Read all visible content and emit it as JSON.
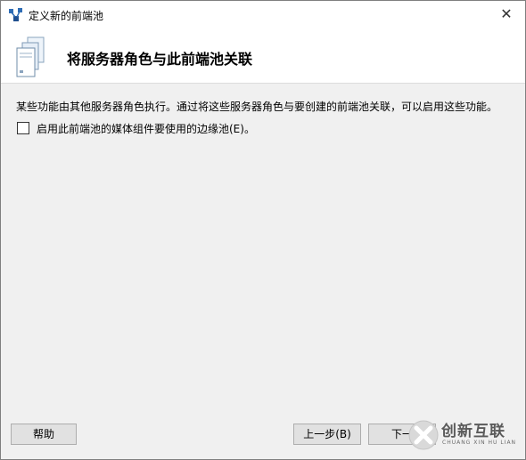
{
  "window": {
    "title": "定义新的前端池",
    "close_glyph": "✕"
  },
  "header": {
    "title": "将服务器角色与此前端池关联",
    "icon": "server-stack-icon"
  },
  "content": {
    "description": "某些功能由其他服务器角色执行。通过将这些服务器角色与要创建的前端池关联，可以启用这些功能。",
    "checkbox": {
      "label": "启用此前端池的媒体组件要使用的边缘池(E)。",
      "checked": false
    }
  },
  "buttons": {
    "help": "帮助",
    "back": "上一步(B)",
    "next": "下一"
  },
  "watermark": {
    "brand": "创新互联",
    "sub": "CHUANG XIN HU LIAN"
  }
}
